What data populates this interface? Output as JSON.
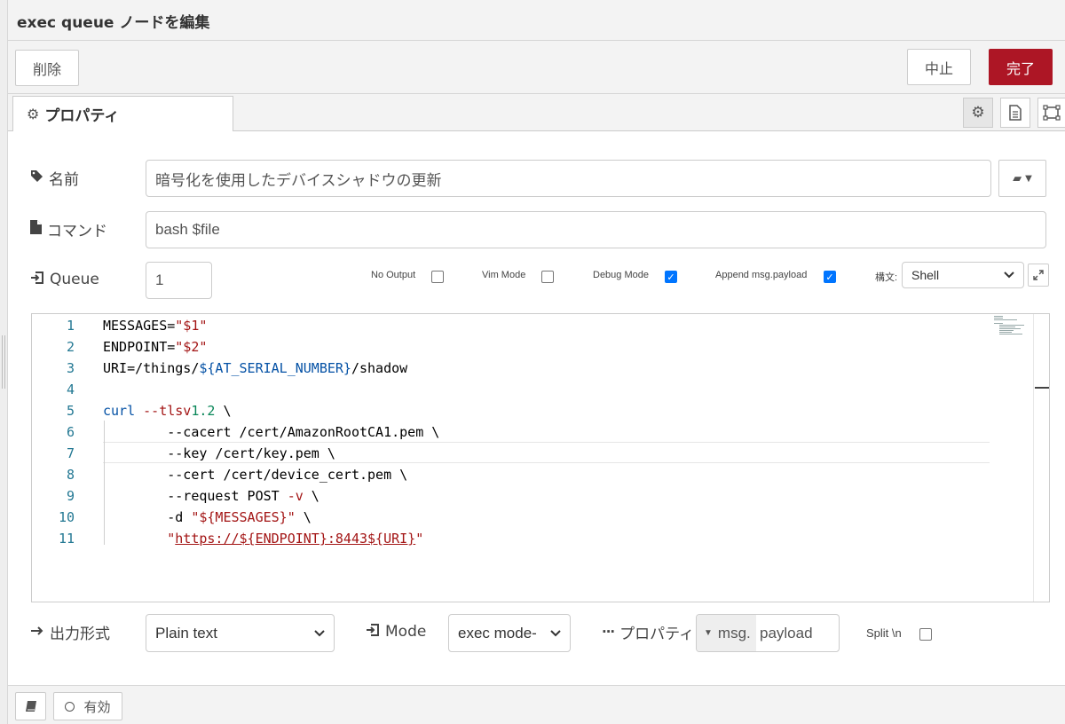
{
  "header": {
    "title": "exec queue ノードを編集"
  },
  "toolbar": {
    "delete_label": "削除",
    "cancel_label": "中止",
    "done_label": "完了"
  },
  "tabs": [
    {
      "label": "プロパティ"
    }
  ],
  "colors": {
    "primary": "#ad1625",
    "checkbox_checked": "#0075ff",
    "line_number": "#237893",
    "string": "#a31515",
    "variable": "#0451a5"
  },
  "form": {
    "name": {
      "label": "名前",
      "value": "暗号化を使用したデバイスシャドウの更新"
    },
    "command": {
      "label": "コマンド",
      "value": "bash $file"
    },
    "queue": {
      "label": "Queue",
      "value": "1"
    },
    "options": [
      {
        "label": "No Output",
        "checked": false
      },
      {
        "label": "Vim Mode",
        "checked": false
      },
      {
        "label": "Debug Mode",
        "checked": true
      },
      {
        "label": "Append msg.payload",
        "checked": true
      }
    ],
    "syntax": {
      "label": "構文:",
      "value": "Shell"
    }
  },
  "editor": {
    "line_numbers": [
      "1",
      "2",
      "3",
      "4",
      "5",
      "6",
      "7",
      "8",
      "9",
      "10",
      "11"
    ],
    "lines": [
      "MESSAGES=\"$1\"",
      "ENDPOINT=\"$2\"",
      "URI=/things/${AT_SERIAL_NUMBER}/shadow",
      "",
      "curl --tlsv1.2 \\",
      "        --cacert /cert/AmazonRootCA1.pem \\",
      "        --key /cert/key.pem \\",
      "        --cert /cert/device_cert.pem \\",
      "        --request POST -v \\",
      "        -d \"${MESSAGES}\" \\",
      "        \"https://${ENDPOINT}:8443${URI}\""
    ]
  },
  "output": {
    "format_label": "出力形式",
    "format_value": "Plain text",
    "mode_label": "Mode",
    "mode_value": "exec mode-",
    "property_label": "プロパティ",
    "property_prefix": "msg.",
    "property_value": "payload",
    "split_label": "Split \\n",
    "split_checked": false
  },
  "footer": {
    "enabled_label": "有効"
  }
}
